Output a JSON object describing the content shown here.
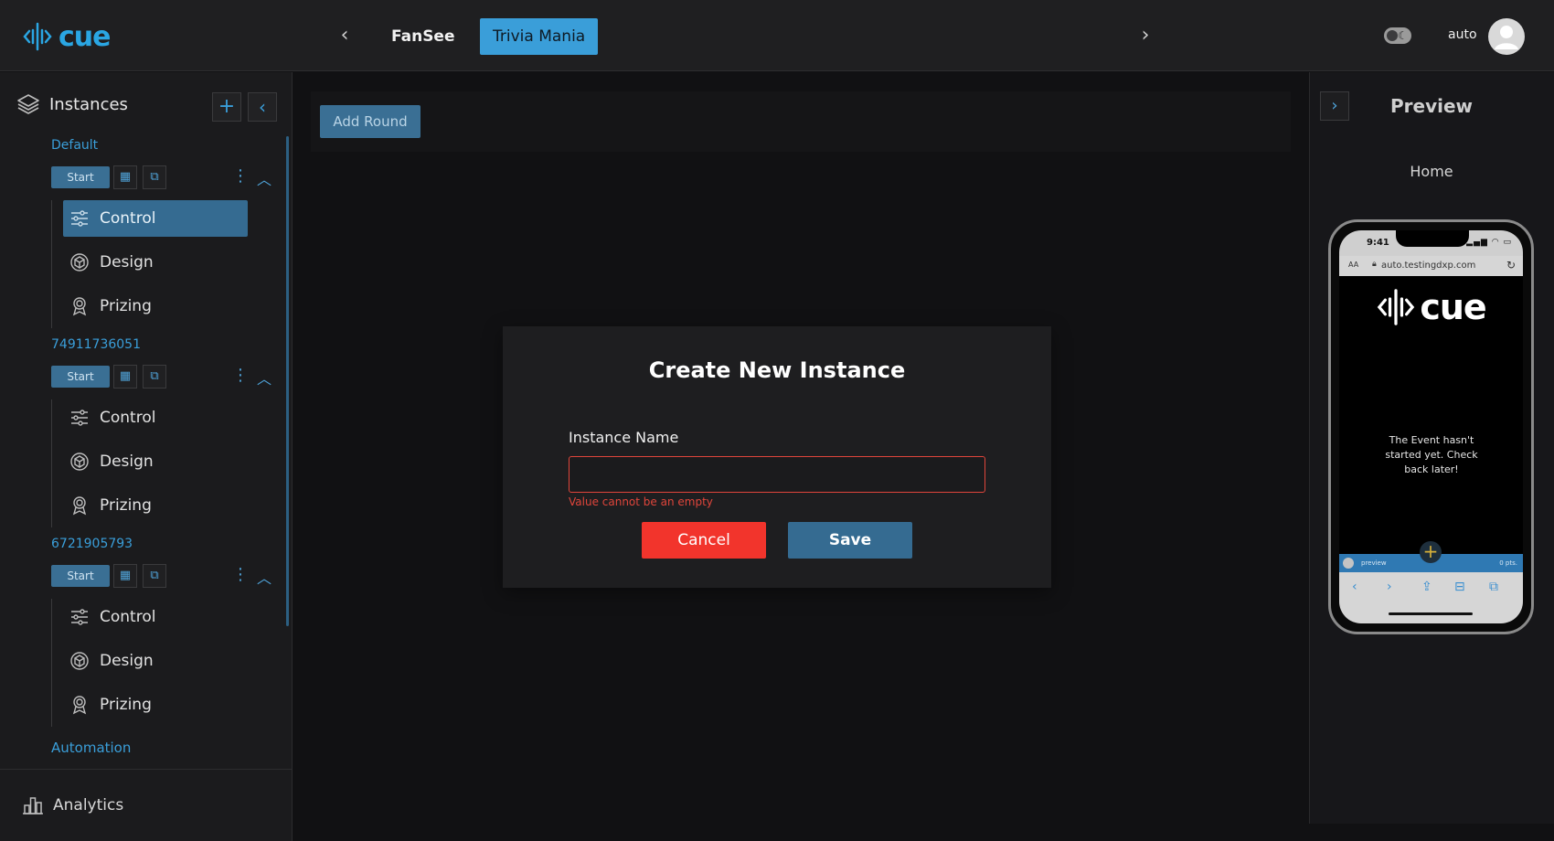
{
  "header": {
    "logo_text": "cue",
    "tabs": [
      {
        "label": "FanSee"
      },
      {
        "label": "Trivia Mania"
      }
    ],
    "user_name": "auto",
    "accent": "#3a9ed9"
  },
  "sidebar": {
    "title": "Instances",
    "instances": [
      {
        "name": "Default",
        "start_label": "Start",
        "items": [
          "Control",
          "Design",
          "Prizing"
        ]
      },
      {
        "name": "74911736051",
        "start_label": "Start",
        "items": [
          "Control",
          "Design",
          "Prizing"
        ]
      },
      {
        "name": "6721905793",
        "start_label": "Start",
        "items": [
          "Control",
          "Design",
          "Prizing"
        ]
      }
    ],
    "active_item": "Control",
    "automation_label": "Automation",
    "analytics_label": "Analytics"
  },
  "main": {
    "add_round_label": "Add Round"
  },
  "modal": {
    "title": "Create New Instance",
    "field_label": "Instance Name",
    "field_value": "",
    "error_text": "Value cannot be an empty",
    "cancel_label": "Cancel",
    "save_label": "Save",
    "cancel_color": "#f2342c",
    "save_color": "#356b91"
  },
  "preview": {
    "title": "Preview",
    "page": "Home",
    "phone": {
      "time": "9:41",
      "aa": "AA",
      "url": "auto.testingdxp.com",
      "logo_text": "cue",
      "message": "The Event hasn't started yet. Check back later!",
      "bar_name": "preview",
      "bar_points": "0 pts."
    }
  }
}
